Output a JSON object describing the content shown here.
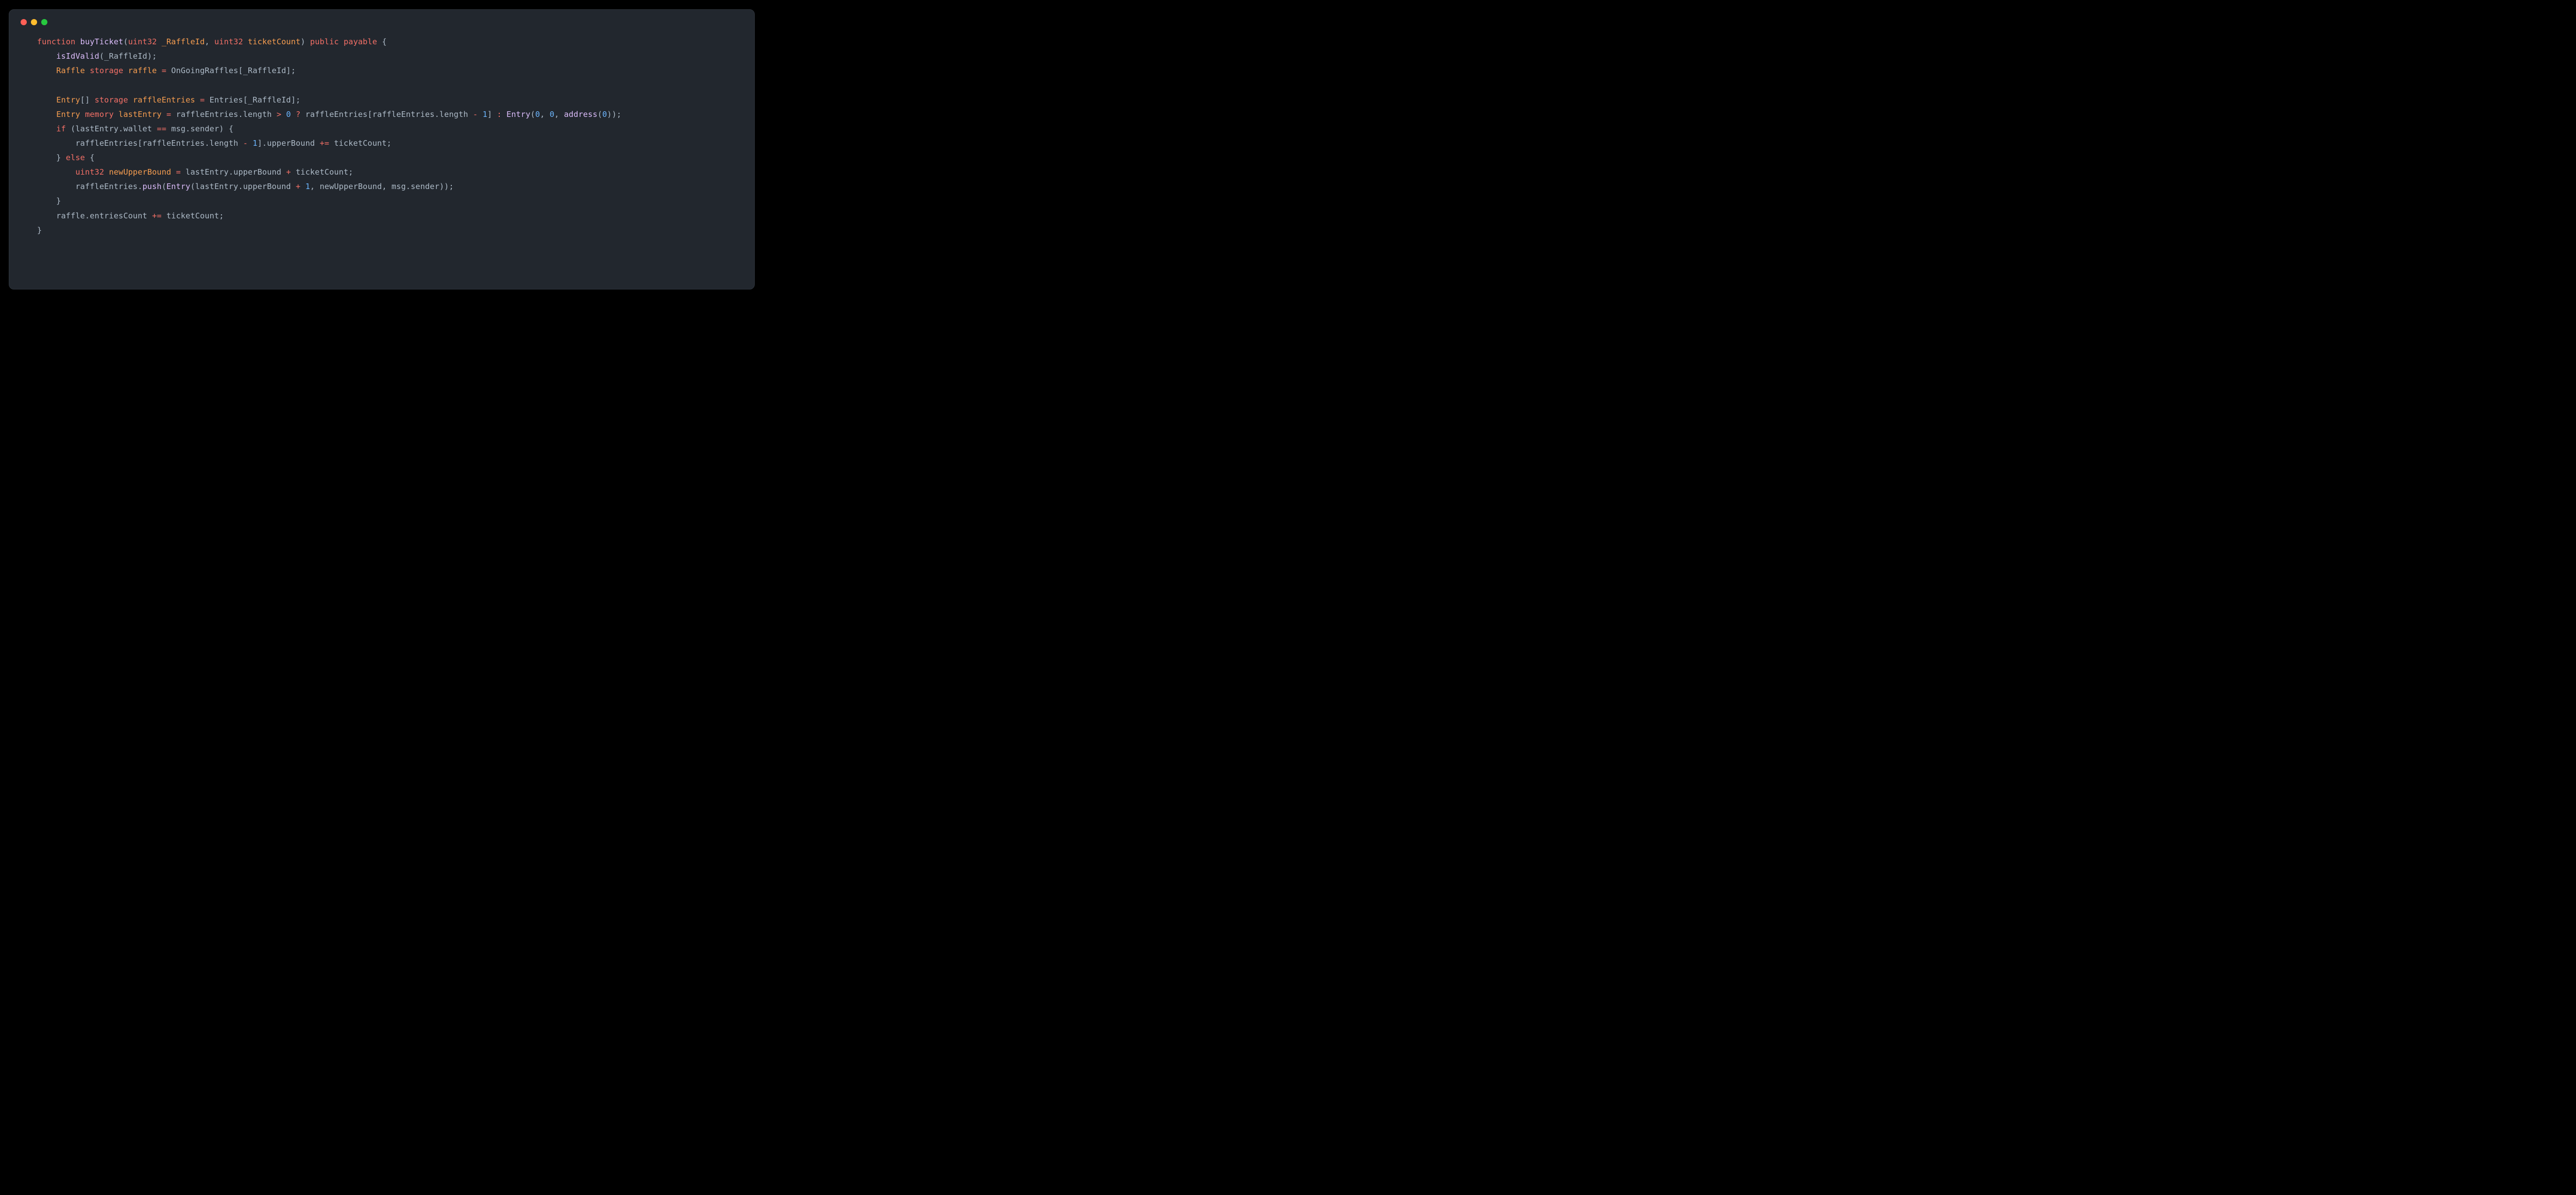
{
  "code": {
    "lines": [
      [
        {
          "t": "function ",
          "c": "kw"
        },
        {
          "t": "buyTicket",
          "c": "fn"
        },
        {
          "t": "(",
          "c": "punc"
        },
        {
          "t": "uint32 ",
          "c": "kw"
        },
        {
          "t": "_RaffleId",
          "c": "ty"
        },
        {
          "t": ", ",
          "c": "punc"
        },
        {
          "t": "uint32 ",
          "c": "kw"
        },
        {
          "t": "ticketCount",
          "c": "ty"
        },
        {
          "t": ") ",
          "c": "punc"
        },
        {
          "t": "public ",
          "c": "kw"
        },
        {
          "t": "payable ",
          "c": "kw"
        },
        {
          "t": "{",
          "c": "punc"
        }
      ],
      [
        {
          "t": "    ",
          "c": ""
        },
        {
          "t": "isIdValid",
          "c": "fn"
        },
        {
          "t": "(_RaffleId);",
          "c": "punc"
        }
      ],
      [
        {
          "t": "    ",
          "c": ""
        },
        {
          "t": "Raffle ",
          "c": "ty"
        },
        {
          "t": "storage ",
          "c": "kw"
        },
        {
          "t": "raffle",
          "c": "ty"
        },
        {
          "t": " ",
          "c": ""
        },
        {
          "t": "=",
          "c": "kw"
        },
        {
          "t": " OnGoingRaffles[_RaffleId];",
          "c": "punc"
        }
      ],
      [
        {
          "t": "",
          "c": ""
        }
      ],
      [
        {
          "t": "    ",
          "c": ""
        },
        {
          "t": "Entry",
          "c": "ty"
        },
        {
          "t": "[] ",
          "c": "punc"
        },
        {
          "t": "storage ",
          "c": "kw"
        },
        {
          "t": "raffleEntries",
          "c": "ty"
        },
        {
          "t": " ",
          "c": ""
        },
        {
          "t": "=",
          "c": "kw"
        },
        {
          "t": " Entries[_RaffleId];",
          "c": "punc"
        }
      ],
      [
        {
          "t": "    ",
          "c": ""
        },
        {
          "t": "Entry ",
          "c": "ty"
        },
        {
          "t": "memory ",
          "c": "kw"
        },
        {
          "t": "lastEntry",
          "c": "ty"
        },
        {
          "t": " ",
          "c": ""
        },
        {
          "t": "=",
          "c": "kw"
        },
        {
          "t": " raffleEntries.length ",
          "c": "punc"
        },
        {
          "t": ">",
          "c": "kw"
        },
        {
          "t": " ",
          "c": ""
        },
        {
          "t": "0",
          "c": "literal"
        },
        {
          "t": " ",
          "c": ""
        },
        {
          "t": "?",
          "c": "kw"
        },
        {
          "t": " raffleEntries[raffleEntries.length ",
          "c": "punc"
        },
        {
          "t": "-",
          "c": "kw"
        },
        {
          "t": " ",
          "c": ""
        },
        {
          "t": "1",
          "c": "literal"
        },
        {
          "t": "] ",
          "c": "punc"
        },
        {
          "t": ":",
          "c": "kw"
        },
        {
          "t": " ",
          "c": ""
        },
        {
          "t": "Entry",
          "c": "fn"
        },
        {
          "t": "(",
          "c": "punc"
        },
        {
          "t": "0",
          "c": "literal"
        },
        {
          "t": ", ",
          "c": "punc"
        },
        {
          "t": "0",
          "c": "literal"
        },
        {
          "t": ", ",
          "c": "punc"
        },
        {
          "t": "address",
          "c": "fn"
        },
        {
          "t": "(",
          "c": "punc"
        },
        {
          "t": "0",
          "c": "literal"
        },
        {
          "t": "));",
          "c": "punc"
        }
      ],
      [
        {
          "t": "    ",
          "c": ""
        },
        {
          "t": "if ",
          "c": "kw"
        },
        {
          "t": "(lastEntry.wallet ",
          "c": "punc"
        },
        {
          "t": "==",
          "c": "kw"
        },
        {
          "t": " msg.sender) {",
          "c": "punc"
        }
      ],
      [
        {
          "t": "        raffleEntries[raffleEntries.length ",
          "c": "punc"
        },
        {
          "t": "-",
          "c": "kw"
        },
        {
          "t": " ",
          "c": ""
        },
        {
          "t": "1",
          "c": "literal"
        },
        {
          "t": "].upperBound ",
          "c": "punc"
        },
        {
          "t": "+=",
          "c": "kw"
        },
        {
          "t": " ticketCount;",
          "c": "punc"
        }
      ],
      [
        {
          "t": "    } ",
          "c": "punc"
        },
        {
          "t": "else ",
          "c": "kw"
        },
        {
          "t": "{",
          "c": "punc"
        }
      ],
      [
        {
          "t": "        ",
          "c": ""
        },
        {
          "t": "uint32 ",
          "c": "kw"
        },
        {
          "t": "newUpperBound",
          "c": "ty"
        },
        {
          "t": " ",
          "c": ""
        },
        {
          "t": "=",
          "c": "kw"
        },
        {
          "t": " lastEntry.upperBound ",
          "c": "punc"
        },
        {
          "t": "+",
          "c": "kw"
        },
        {
          "t": " ticketCount;",
          "c": "punc"
        }
      ],
      [
        {
          "t": "        raffleEntries.",
          "c": "punc"
        },
        {
          "t": "push",
          "c": "fn"
        },
        {
          "t": "(",
          "c": "punc"
        },
        {
          "t": "Entry",
          "c": "fn"
        },
        {
          "t": "(lastEntry.upperBound ",
          "c": "punc"
        },
        {
          "t": "+",
          "c": "kw"
        },
        {
          "t": " ",
          "c": ""
        },
        {
          "t": "1",
          "c": "literal"
        },
        {
          "t": ", newUpperBound, msg.sender));",
          "c": "punc"
        }
      ],
      [
        {
          "t": "    }",
          "c": "punc"
        }
      ],
      [
        {
          "t": "    raffle.entriesCount ",
          "c": "punc"
        },
        {
          "t": "+=",
          "c": "kw"
        },
        {
          "t": " ticketCount;",
          "c": "punc"
        }
      ],
      [
        {
          "t": "}",
          "c": "punc"
        }
      ]
    ]
  }
}
